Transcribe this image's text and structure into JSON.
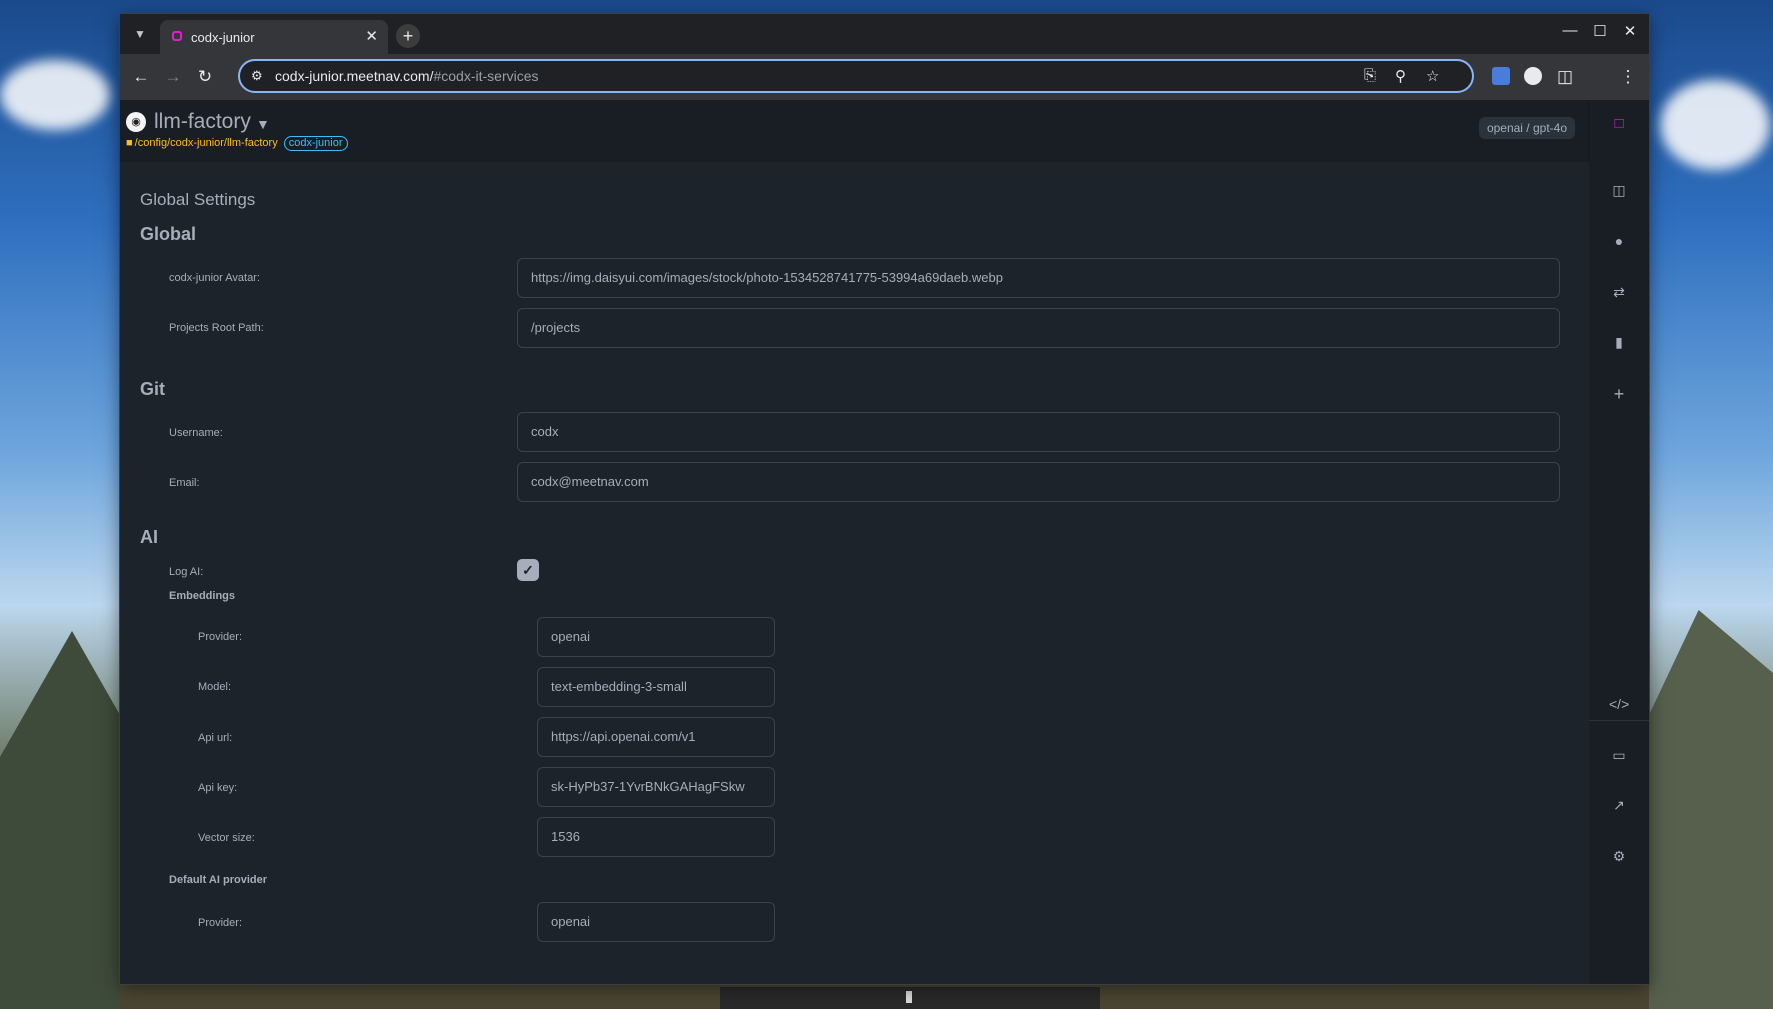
{
  "browser": {
    "tab_title": "codx-junior",
    "new_tab": "+",
    "url_host": "codx-junior.meetnav.com/",
    "url_path": "#codx-it-services"
  },
  "app": {
    "project_name": "llm-factory",
    "project_path": "/config/codx-junior/llm-factory",
    "project_badge": "codx-junior",
    "model": "openai / gpt-4o"
  },
  "settings": {
    "page_title": "Global Settings",
    "global": {
      "heading": "Global",
      "avatar_label": "codx-junior Avatar:",
      "avatar_value": "https://img.daisyui.com/images/stock/photo-1534528741775-53994a69daeb.webp",
      "root_label": "Projects Root Path:",
      "root_value": "/projects"
    },
    "git": {
      "heading": "Git",
      "username_label": "Username:",
      "username_value": "codx",
      "email_label": "Email:",
      "email_value": "codx@meetnav.com"
    },
    "ai": {
      "heading": "AI",
      "log_label": "Log AI:",
      "log_checked": true,
      "embeddings": {
        "heading": "Embeddings",
        "provider_label": "Provider:",
        "provider_value": "openai",
        "model_label": "Model:",
        "model_value": "text-embedding-3-small",
        "api_url_label": "Api url:",
        "api_url_value": "https://api.openai.com/v1",
        "api_key_label": "Api key:",
        "api_key_value": "sk-HyPb37-1YvrBNkGAHagFSkw",
        "vector_label": "Vector size:",
        "vector_value": "1536"
      },
      "default_provider": {
        "heading": "Default AI provider",
        "provider_label": "Provider:",
        "provider_value": "openai"
      }
    }
  },
  "sidebar_icons": [
    "codx-logo-icon",
    "kanban-icon",
    "profile-icon",
    "pull-request-icon",
    "book-icon",
    "add-icon",
    "code-icon",
    "monitor-icon",
    "chart-icon",
    "settings-icon"
  ]
}
